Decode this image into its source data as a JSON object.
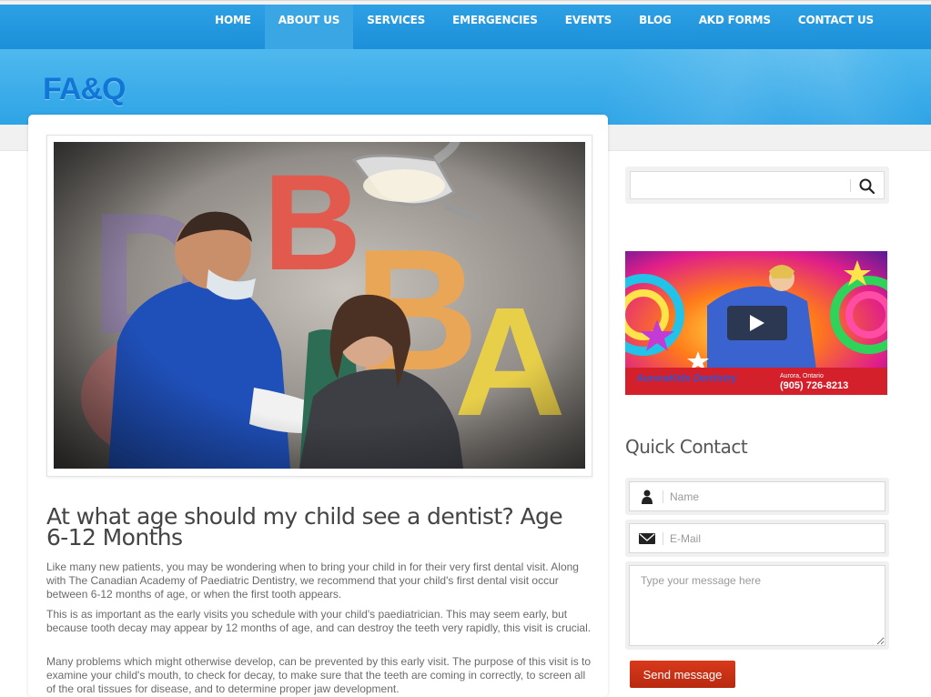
{
  "nav": {
    "items": [
      {
        "label": "HOME",
        "active": false
      },
      {
        "label": "ABOUT US",
        "active": true
      },
      {
        "label": "SERVICES",
        "active": false
      },
      {
        "label": "EMERGENCIES",
        "active": false
      },
      {
        "label": "EVENTS",
        "active": false
      },
      {
        "label": "BLOG",
        "active": false
      },
      {
        "label": "AKD FORMS",
        "active": false
      },
      {
        "label": "CONTACT US",
        "active": false
      }
    ]
  },
  "banner": {
    "title": "FA&Q"
  },
  "article": {
    "title": "At what age should my child see a dentist? Age 6-12 Months",
    "paragraphs": [
      "Like many new patients, you may be wondering when to bring your child in for their very first dental visit.  Along with The Canadian Academy of Paediatric Dentistry, we recommend that your child's first dental visit occur between 6-12 months of age, or when the first tooth appears.",
      "This is as important as the early visits you schedule with your child's paediatrician.  This may seem early, but because tooth decay may appear by 12 months of age, and can destroy the teeth very rapidly, this visit is crucial.",
      "Many problems which might otherwise develop, can be prevented by this early visit.  The purpose of this visit is to examine your child's mouth, to check for decay, to make sure that the teeth are coming in correctly, to screen all of the oral tissues for disease, and to determine proper jaw development."
    ],
    "hero_letters": [
      "B",
      "B",
      "A",
      "D"
    ]
  },
  "sidebar": {
    "search": {
      "placeholder": "",
      "icon": "search-icon"
    },
    "video": {
      "brand": "AuroraKids Dentistry",
      "location": "Aurora, Ontario",
      "phone": "(905) 726-8213",
      "icon": "play-icon"
    },
    "quick_contact": {
      "title": "Quick Contact",
      "name_placeholder": "Name",
      "email_placeholder": "E-Mail",
      "message_placeholder": "Type your message here",
      "send_label": "Send message"
    }
  },
  "colors": {
    "nav_bg": "#1b8fd8",
    "banner_bg": "#3aaae8",
    "title_blue": "#1177d6",
    "send_button": "#c8341a"
  }
}
